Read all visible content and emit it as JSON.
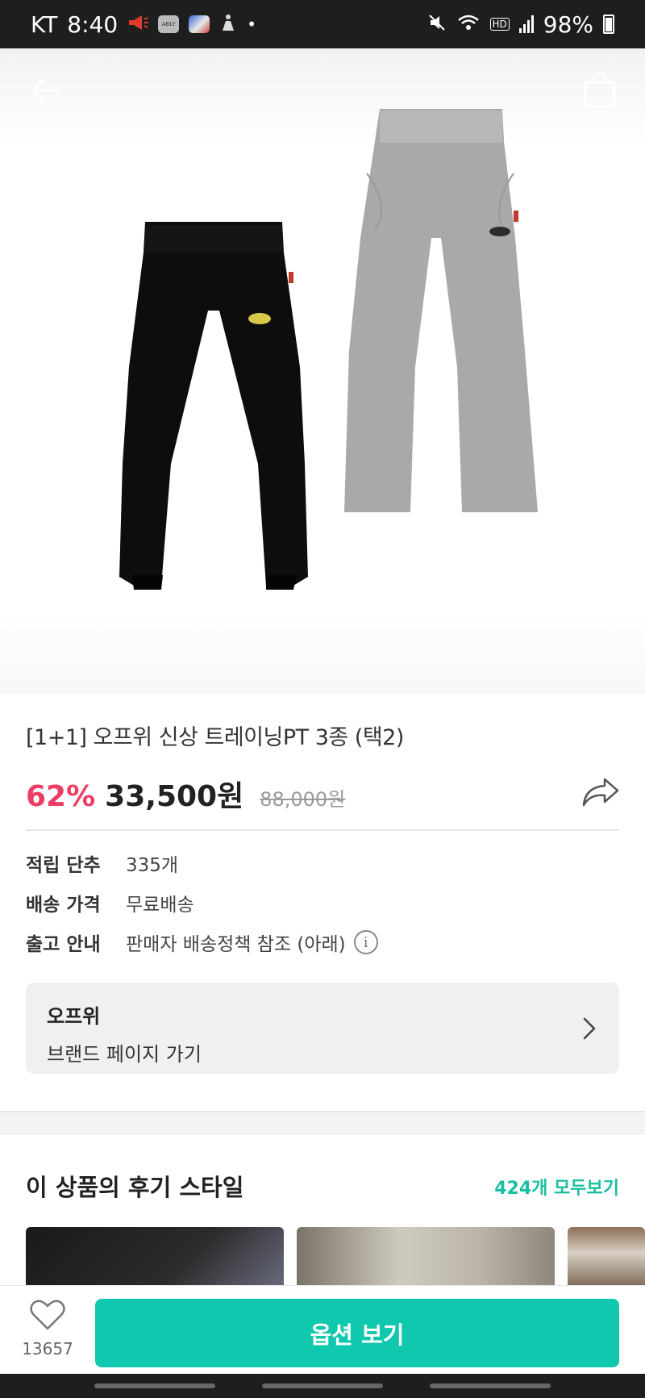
{
  "status_bar": {
    "carrier": "KT",
    "time": "8:40",
    "app_badge": "ABLY",
    "battery": "98%",
    "hd_label": "HD"
  },
  "header": {
    "back_icon": "arrow-left-icon",
    "cart_icon": "shopping-bag-icon"
  },
  "product": {
    "title": "[1+1] 오프위 신상 트레이닝PT 3종 (택2)",
    "discount": "62%",
    "price": "33,500원",
    "original_price": "88,000원",
    "share_icon": "share-arrow-icon"
  },
  "info": [
    {
      "label": "적립 단추",
      "value": "335개"
    },
    {
      "label": "배송 가격",
      "value": "무료배송"
    },
    {
      "label": "출고 안내",
      "value": "판매자 배송정책 참조 (아래)"
    }
  ],
  "brand": {
    "name": "오프위",
    "link": "브랜드 페이지 가기"
  },
  "reviews": {
    "title": "이 상품의 후기 스타일",
    "more": "424개 모두보기"
  },
  "bottom": {
    "like_count": "13657",
    "cta": "옵션 보기"
  },
  "colors": {
    "accent": "#10c8ad",
    "discount": "#ee3d64",
    "link": "#19bfa0"
  }
}
